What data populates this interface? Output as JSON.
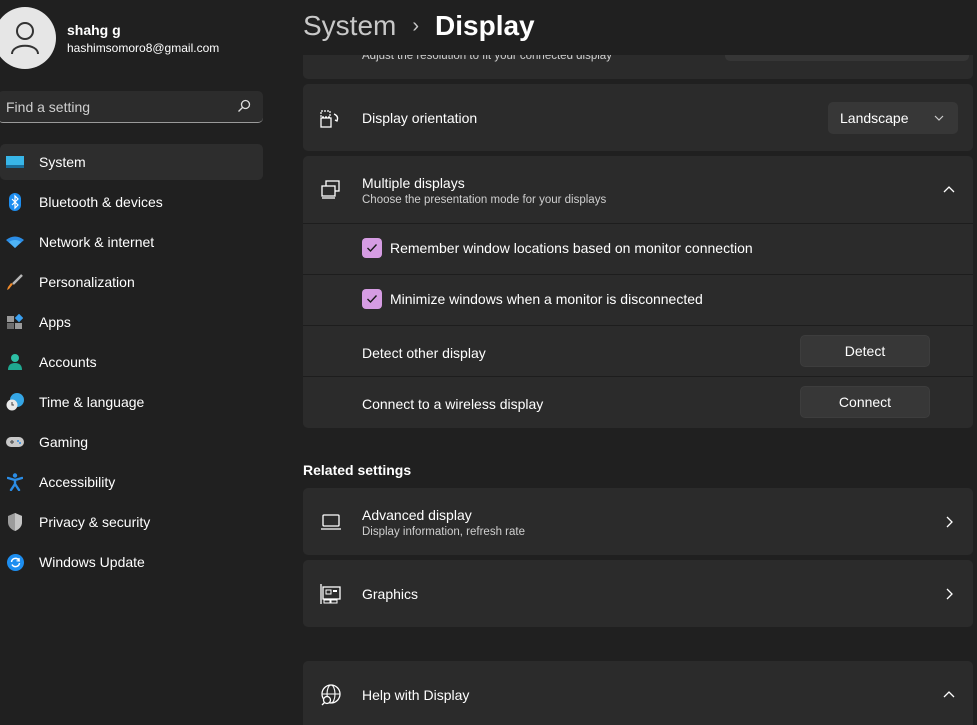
{
  "profile": {
    "name": "shahg g",
    "email": "hashimsomoro8@gmail.com"
  },
  "search": {
    "placeholder": "Find a setting",
    "value": ""
  },
  "sidebar": {
    "items": [
      {
        "label": "System",
        "icon": "system-icon",
        "active": true
      },
      {
        "label": "Bluetooth & devices",
        "icon": "bluetooth-icon"
      },
      {
        "label": "Network & internet",
        "icon": "wifi-icon"
      },
      {
        "label": "Personalization",
        "icon": "brush-icon"
      },
      {
        "label": "Apps",
        "icon": "apps-icon"
      },
      {
        "label": "Accounts",
        "icon": "person-icon"
      },
      {
        "label": "Time & language",
        "icon": "clock-globe-icon"
      },
      {
        "label": "Gaming",
        "icon": "controller-icon"
      },
      {
        "label": "Accessibility",
        "icon": "accessibility-icon"
      },
      {
        "label": "Privacy & security",
        "icon": "shield-icon"
      },
      {
        "label": "Windows Update",
        "icon": "update-icon"
      }
    ]
  },
  "breadcrumb": {
    "parent": "System",
    "separator": "›",
    "current": "Display"
  },
  "resolution": {
    "subtitle": "Adjust the resolution to fit your connected display"
  },
  "orientation": {
    "title": "Display orientation",
    "value": "Landscape"
  },
  "multiple_displays": {
    "title": "Multiple displays",
    "subtitle": "Choose the presentation mode for your displays",
    "expanded": true,
    "options": [
      {
        "label": "Remember window locations based on monitor connection",
        "checked": true
      },
      {
        "label": "Minimize windows when a monitor is disconnected",
        "checked": true
      }
    ],
    "detect": {
      "label": "Detect other display",
      "button": "Detect"
    },
    "connect": {
      "label": "Connect to a wireless display",
      "button": "Connect"
    }
  },
  "related": {
    "title": "Related settings",
    "advanced": {
      "title": "Advanced display",
      "subtitle": "Display information, refresh rate"
    },
    "graphics": {
      "title": "Graphics"
    }
  },
  "help": {
    "title": "Help with Display",
    "expanded": true
  },
  "colors": {
    "accent": "#d69ce3",
    "background": "#202020",
    "card": "#2b2b2b"
  }
}
